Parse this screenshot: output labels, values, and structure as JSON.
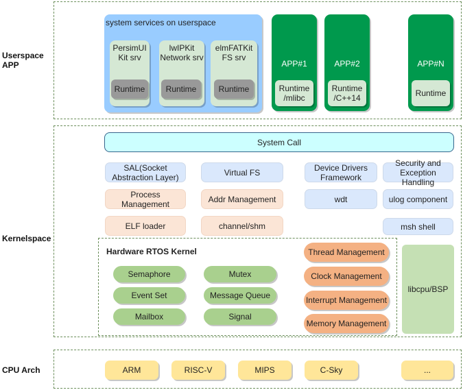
{
  "layers": {
    "userspace": {
      "label": "Userspace\nAPP",
      "label_line1": "Userspace",
      "label_line2": "APP",
      "system_services": {
        "title": "system services on userspace",
        "services": [
          {
            "line1": "PersimUI",
            "line2": "Kit srv",
            "runtime": "Runtime"
          },
          {
            "line1": "lwIPKit",
            "line2": "Network srv",
            "runtime": "Runtime"
          },
          {
            "line1": "elmFATKit",
            "line2": "FS srv",
            "runtime": "Runtime"
          }
        ]
      },
      "apps": [
        {
          "name": "APP#1",
          "runtime_line1": "Runtime",
          "runtime_line2": "/mlibc"
        },
        {
          "name": "APP#2",
          "runtime_line1": "Runtime",
          "runtime_line2": "/C++14"
        },
        {
          "name": "APP#N",
          "runtime_line1": "Runtime",
          "runtime_line2": ""
        }
      ]
    },
    "kernelspace": {
      "label": "Kernelspace",
      "system_call": "System Call",
      "components": {
        "sal_line1": "SAL(Socket",
        "sal_line2": "Abstraction Layer)",
        "virtual_fs": "Virtual FS",
        "device_drivers_line1": "Device Drivers",
        "device_drivers_line2": "Framework",
        "security_line1": "Security and",
        "security_line2": "Exception Handling",
        "process_mgmt": "Process Management",
        "addr_mgmt": "Addr Management",
        "wdt": "wdt",
        "ulog": "ulog component",
        "elf_loader": "ELF loader",
        "channel_shm": "channel/shm",
        "msh_shell": "msh shell",
        "libcpu_bsp": "libcpu/BSP"
      },
      "rtos_kernel": {
        "title": "Hardware RTOS Kernel",
        "ipc": [
          "Semaphore",
          "Mutex",
          "Event Set",
          "Message Queue",
          "Mailbox",
          "Signal"
        ],
        "management": [
          "Thread Management",
          "Clock Management",
          "Interrupt Management",
          "Memory Management"
        ]
      }
    },
    "cpu_arch": {
      "label": "CPU Arch",
      "archs": [
        "ARM",
        "RISC-V",
        "MIPS",
        "C-Sky",
        "..."
      ]
    }
  },
  "colors": {
    "app_green": "#00994d",
    "services_blue": "#99ccff",
    "syscall_cyan": "#ccffff",
    "ipc_green": "#a9d08e",
    "mgmt_orange": "#f4b183",
    "arch_yellow": "#ffe699",
    "zone_border": "#6b8e5a"
  }
}
